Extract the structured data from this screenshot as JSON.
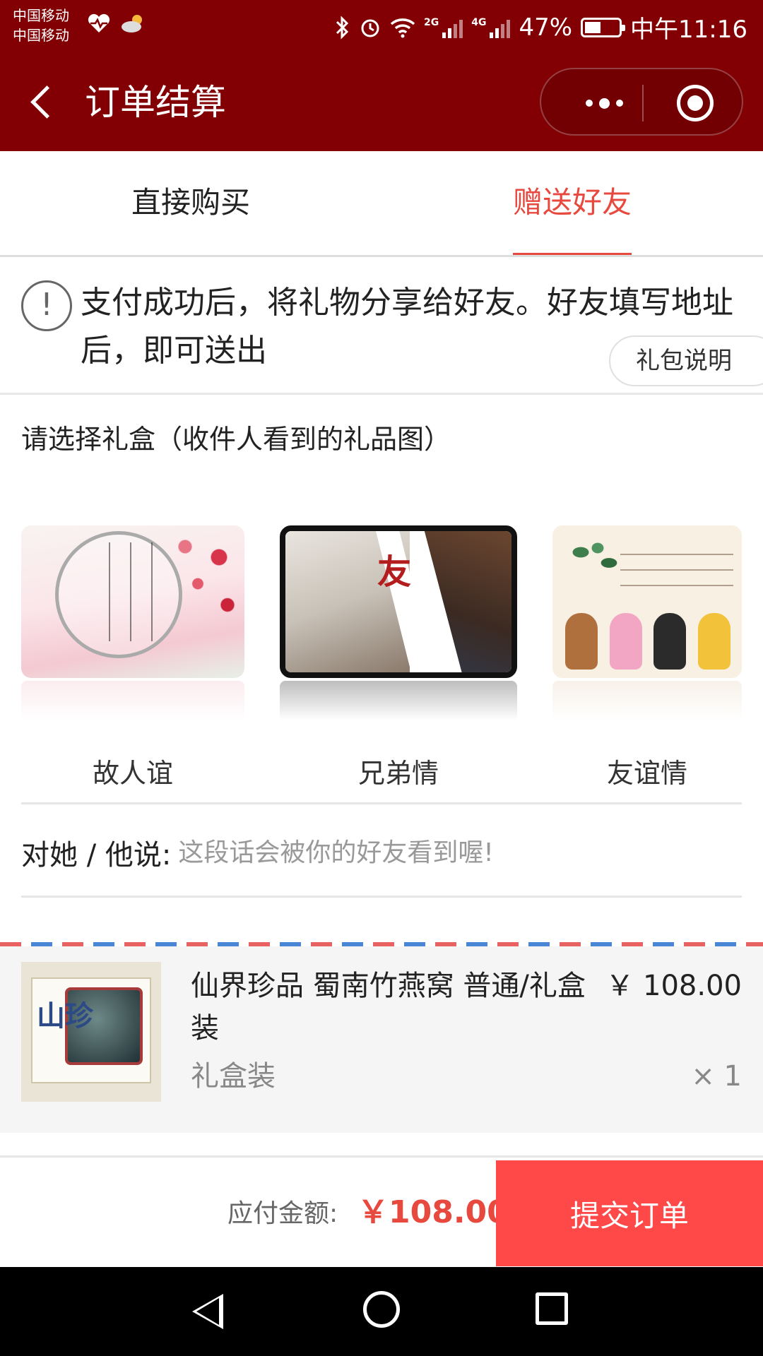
{
  "status_bar": {
    "carrier_1": "中国移动",
    "carrier_2": "中国移动",
    "net_2g": "2G",
    "net_4g": "4G",
    "battery": "47%",
    "battery_level": 0.47,
    "time": "中午11:16"
  },
  "nav": {
    "title": "订单结算"
  },
  "tabs": [
    {
      "label": "直接购买",
      "active": false
    },
    {
      "label": "赠送好友",
      "active": true
    }
  ],
  "notice": {
    "text": "支付成功后，将礼物分享给好友。好友填写地址后，即可送出",
    "icon": "!",
    "button_label": "礼包说明"
  },
  "gift_box": {
    "title": "请选择礼盒（收件人看到的礼品图）",
    "options": [
      {
        "label": "故人谊"
      },
      {
        "label": "兄弟情",
        "overlay_text": "友"
      },
      {
        "label": "友谊情"
      }
    ]
  },
  "message": {
    "label": "对她 / 他说:",
    "placeholder": "这段话会被你的好友看到喔!"
  },
  "product": {
    "title": "仙界珍品 蜀南竹燕窝 普通/礼盒装",
    "price": "￥ 108.00",
    "spec": "礼盒装",
    "quantity": "× 1",
    "image_text": "山珍"
  },
  "footer": {
    "total_label": "应付金额:",
    "total_value": "￥108.00",
    "submit_label": "提交订单"
  },
  "colors": {
    "header_bg": "#820004",
    "accent": "#e8493e",
    "submit_bg": "#ff4949"
  }
}
